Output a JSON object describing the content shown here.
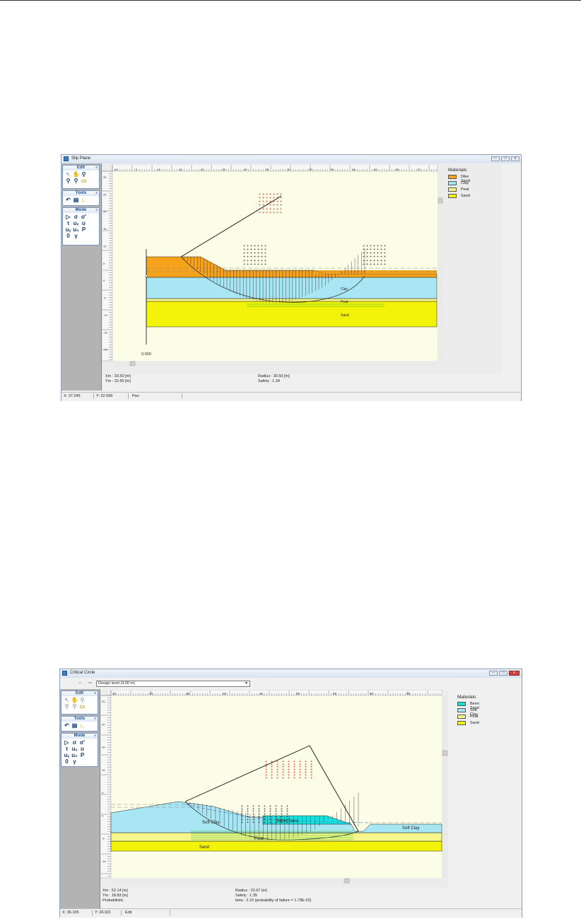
{
  "windows": [
    {
      "title": "Slip Plane",
      "status": {
        "x": "X: 37.245",
        "y": "Y: 32.599",
        "mode": "Pan"
      },
      "info": {
        "xm": "Xm : 33.50 [m]",
        "ym": "Ym : 22.50 [m]",
        "radius": "Radius : 30.50 [m]",
        "safety": "Safety : 1.34"
      },
      "origin_label": "0.000",
      "legend": {
        "title": "Materials",
        "items": [
          {
            "label": "Dike Sand",
            "color": "#f7a21b"
          },
          {
            "label": "Clay",
            "color": "#a8e6f3"
          },
          {
            "label": "Peat",
            "color": "#f5f58c"
          },
          {
            "label": "Sand",
            "color": "#f3f30a"
          }
        ]
      },
      "toolbar": {
        "edit": "Edit",
        "tools": "Tools",
        "mode": "Mode"
      },
      "layer_labels": [
        "Clay",
        "Peat",
        "Sand"
      ],
      "x_ticks": [
        "-10",
        "0",
        "10",
        "15",
        "20",
        "25",
        "30",
        "35",
        "40",
        "45",
        "50",
        "55",
        "60",
        "65",
        "70"
      ],
      "y_ticks": [
        "30",
        "25",
        "20",
        "15",
        "10",
        "5",
        "0",
        "-5",
        "-10",
        "-15",
        "-20"
      ]
    },
    {
      "title": "Critical Circle",
      "dropdown": "Design level (4.00 m)",
      "status": {
        "x": "X: 36.105",
        "y": "Y: 26.921",
        "mode": "Edit"
      },
      "info": {
        "xm": "Xm : 52.14 [m]",
        "ym": "Ym : 18.83 [m]",
        "prob": "Probabilistic",
        "radius": "Radius : 22.67 [m]",
        "safety": "Safety : 1.35",
        "beta": "beta : 2.10  (probability of failure = 1.79E-02)"
      },
      "legend": {
        "title": "Materials",
        "items": [
          {
            "label": "Berm Sand",
            "color": "#16e0dc"
          },
          {
            "label": "Soft Clay",
            "color": "#a8e6f3"
          },
          {
            "label": "Peat",
            "color": "#f5f58c"
          },
          {
            "label": "Sand",
            "color": "#f3f30a"
          }
        ]
      },
      "toolbar": {
        "edit": "Edit",
        "tools": "Tools",
        "mode": "Mode"
      },
      "layer_labels": [
        "Berm Sand",
        "Soft Clay",
        "Soft Clay",
        "Peat",
        "Sand"
      ],
      "x_ticks": [
        "25",
        "30",
        "35",
        "40",
        "45",
        "50",
        "55",
        "60",
        "65"
      ],
      "y_ticks": [
        "25",
        "20",
        "15",
        "10",
        "5",
        "0",
        "-5",
        "-10"
      ]
    }
  ]
}
